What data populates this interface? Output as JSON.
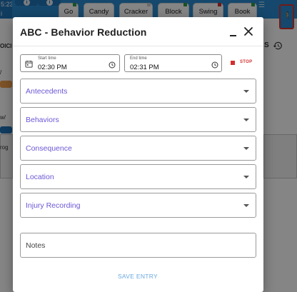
{
  "background": {
    "clock_time": "5:23",
    "clock_sub": "i",
    "tiles": [
      {
        "label": "Go",
        "color": "#2e9e49"
      },
      {
        "label": "Candy",
        "color": "#ffffff"
      },
      {
        "label": "Cracker",
        "color": "#cccccc"
      },
      {
        "label": "Block",
        "color": "#2e9e49"
      },
      {
        "label": "Swing",
        "color": "#d32f2f"
      },
      {
        "label": "Book",
        "color": "#2e9e49"
      }
    ],
    "menu_icon": "hamburger-icon",
    "person_icon": "person-icon",
    "left_labels": [
      "OICI",
      "/",
      "w/",
      "rog"
    ],
    "right_label": "S",
    "history_icon": "history-icon"
  },
  "dialog": {
    "title": "ABC - Behavior Reduction",
    "start_time_caption": "Start time",
    "start_time_value": "02:30 PM",
    "end_time_caption": "End time",
    "end_time_value": "02:31 PM",
    "stop_label": "STOP",
    "fields": [
      {
        "label": "Antecedents"
      },
      {
        "label": "Behaviors"
      },
      {
        "label": "Consequence"
      },
      {
        "label": "Location"
      },
      {
        "label": "Injury Recording"
      }
    ],
    "notes_placeholder": "Notes",
    "save_label": "SAVE ENTRY"
  },
  "colors": {
    "accent": "#6b57d6",
    "topbar": "#2a8ad0",
    "stop": "#d32f2f",
    "save": "#6aa9e0"
  }
}
